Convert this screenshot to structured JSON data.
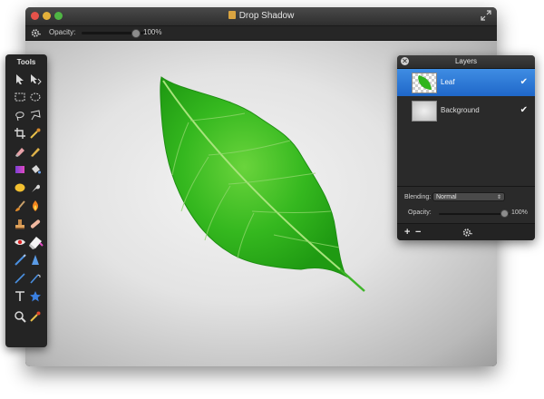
{
  "window": {
    "title": "Drop Shadow"
  },
  "toolbar": {
    "opacity_label": "Opacity:",
    "opacity_value": "100%"
  },
  "tools_panel": {
    "title": "Tools"
  },
  "layers_panel": {
    "title": "Layers",
    "layers": [
      {
        "name": "Leaf",
        "visible": true,
        "selected": true
      },
      {
        "name": "Background",
        "visible": true,
        "selected": false
      }
    ],
    "blending_label": "Blending:",
    "blending_value": "Normal",
    "opacity_label": "Opacity:",
    "opacity_value": "100%"
  },
  "colors": {
    "selection_blue": "#2a78d6",
    "leaf_green": "#2fb51d"
  },
  "icons": {
    "tools": [
      "pointer-icon",
      "move-icon",
      "rect-select-icon",
      "ellipse-select-icon",
      "lasso-icon",
      "polygon-lasso-icon",
      "crop-icon",
      "eyedropper-icon",
      "eraser-icon",
      "pencil-icon",
      "gradient-icon",
      "paint-bucket-icon",
      "sponge-icon",
      "smudge-icon",
      "brush-icon",
      "burn-icon",
      "stamp-icon",
      "heal-icon",
      "red-eye-icon",
      "eraser-block-icon",
      "pen-icon",
      "sharpen-icon",
      "line-icon",
      "curve-pen-icon",
      "text-icon",
      "shape-star-icon",
      "zoom-icon",
      "color-picker-icon"
    ]
  }
}
